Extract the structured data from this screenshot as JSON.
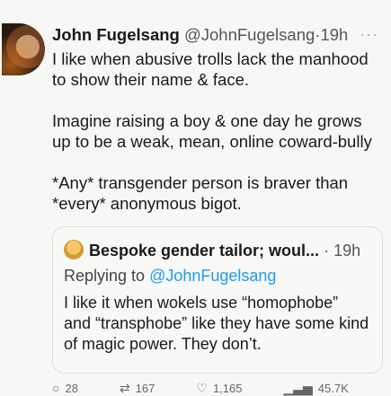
{
  "author": {
    "name": "John Fugelsang",
    "handle": "@JohnFugelsang",
    "separator": "·",
    "time": "19h"
  },
  "more_icon": "···",
  "tweet_paragraphs": [
    "I like when abusive trolls lack the manhood to show their name & face.",
    "Imagine raising a boy & one day he grows up to be a weak, mean, online coward-bully",
    "*Any* transgender person is braver than *every* anonymous bigot."
  ],
  "quoted": {
    "name": "Bespoke gender tailor; woul...",
    "separator": "·",
    "time": "19h",
    "replying_prefix": "Replying to ",
    "replying_handle": "@JohnFugelsang",
    "text": "I like it when wokels use “homophobe” and “transphobe” like they have some kind of magic power. They don’t."
  },
  "actions": {
    "replies": "28",
    "retweets": "167",
    "likes": "1,165",
    "views": "45.7K"
  },
  "colors": {
    "link": "#1d9bf0"
  }
}
